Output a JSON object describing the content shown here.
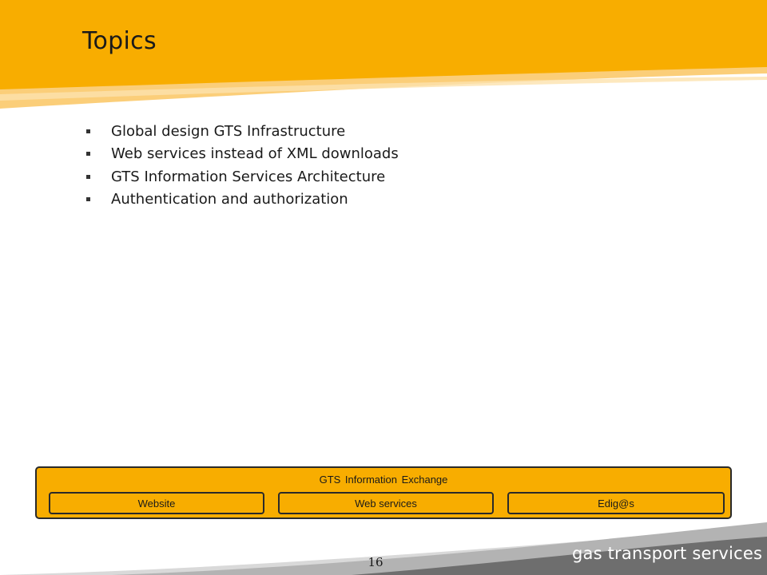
{
  "slide": {
    "title": "Topics",
    "topics": [
      "Global design GTS Infrastructure",
      "Web services instead of XML downloads",
      "GTS Information Services Architecture",
      "Authentication and authorization"
    ],
    "page_number": "16"
  },
  "exchange": {
    "title": "GTS  Information  Exchange",
    "boxes": [
      "Website",
      "Web services",
      "Edig@s"
    ]
  },
  "brand": {
    "name": "gas transport services"
  },
  "colors": {
    "accent": "#F8AD00",
    "accent_light": "#FBC96A",
    "footer_dark": "#6E6E6E"
  }
}
